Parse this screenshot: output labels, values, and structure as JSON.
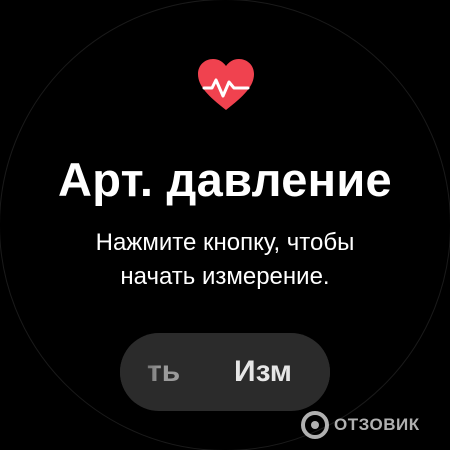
{
  "app": {
    "title": "Арт. давление",
    "instruction_line1": "Нажмите кнопку, чтобы",
    "instruction_line2": "начать измерение."
  },
  "button": {
    "prev_label_fragment": "ть",
    "label_fragment": "Изм"
  },
  "icons": {
    "header": "heart-pulse-icon"
  },
  "watermark": {
    "text": "ОТЗОВИК"
  },
  "colors": {
    "background": "#000000",
    "heart": "#f0424f",
    "button_bg": "#2b2b2b",
    "text": "#ffffff"
  }
}
